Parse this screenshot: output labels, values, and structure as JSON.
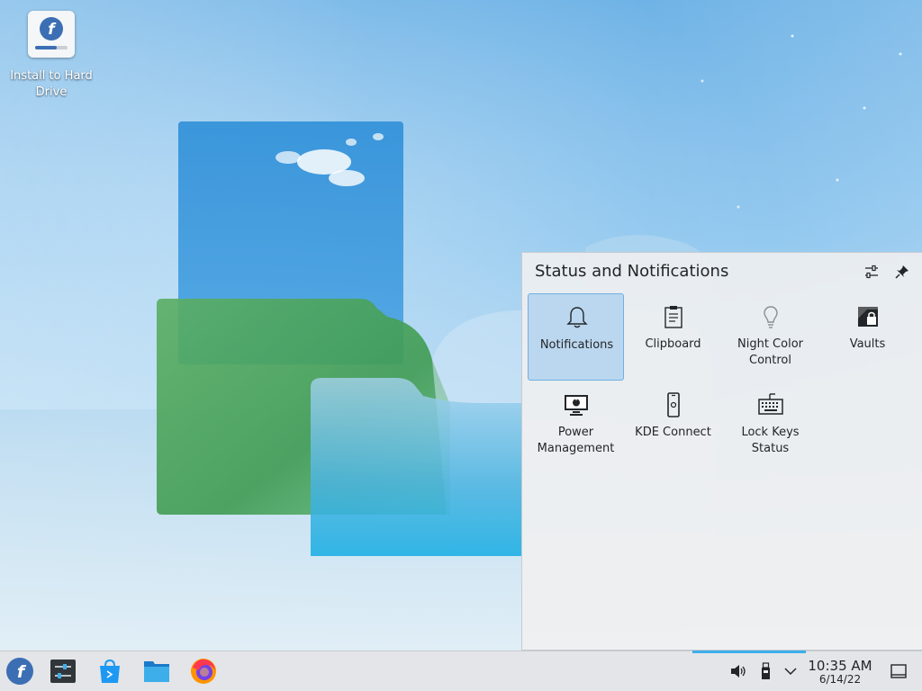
{
  "desktop": {
    "icons": [
      {
        "label": "Install to Hard Drive",
        "icon": "fedora-installer-icon"
      }
    ]
  },
  "popup": {
    "title": "Status and Notifications",
    "header_buttons": [
      {
        "icon": "configure-icon"
      },
      {
        "icon": "pin-icon"
      }
    ],
    "items": [
      {
        "label": "Notifications",
        "icon": "bell-icon",
        "selected": true
      },
      {
        "label": "Clipboard",
        "icon": "clipboard-icon"
      },
      {
        "label": "Night Color Control",
        "icon": "lightbulb-icon"
      },
      {
        "label": "Vaults",
        "icon": "vault-icon"
      },
      {
        "label": "Power Management",
        "icon": "monitor-power-icon"
      },
      {
        "label": "KDE Connect",
        "icon": "phone-icon"
      },
      {
        "label": "Lock Keys Status",
        "icon": "keyboard-icon"
      }
    ]
  },
  "taskbar": {
    "launchers": [
      {
        "icon": "fedora-logo-icon"
      },
      {
        "icon": "system-settings-icon"
      },
      {
        "icon": "software-center-icon"
      },
      {
        "icon": "file-manager-icon"
      },
      {
        "icon": "firefox-icon"
      }
    ],
    "tray": [
      {
        "icon": "volume-icon"
      },
      {
        "icon": "usb-device-icon"
      },
      {
        "icon": "chevron-down-icon"
      }
    ],
    "clock": {
      "time": "10:35 AM",
      "date": "6/14/22"
    },
    "show_desktop_icon": "show-desktop-icon"
  },
  "colors": {
    "accent": "#3daee9",
    "fedora_blue": "#3c6eb4",
    "selection": "#93c4ec"
  }
}
